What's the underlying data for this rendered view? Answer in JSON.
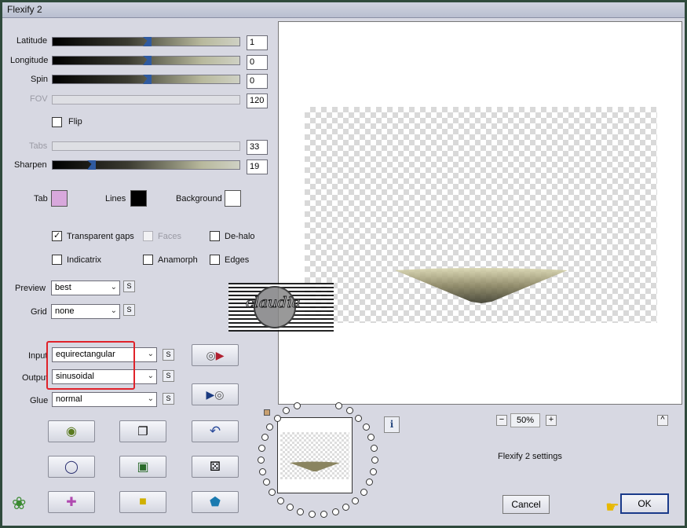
{
  "window": {
    "title": "Flexify 2"
  },
  "sliders": [
    {
      "label": "Latitude",
      "value": "1",
      "enabled": true,
      "level": 0.5
    },
    {
      "label": "Longitude",
      "value": "0",
      "enabled": true,
      "level": 0.5
    },
    {
      "label": "Spin",
      "value": "0",
      "enabled": true,
      "level": 0.5
    },
    {
      "label": "FOV",
      "value": "120",
      "enabled": false,
      "level": 0
    },
    {
      "label": "Tabs",
      "value": "33",
      "enabled": false,
      "level": 0
    },
    {
      "label": "Sharpen",
      "value": "19",
      "enabled": true,
      "level": 0.2
    }
  ],
  "flip": {
    "label": "Flip",
    "checked": false
  },
  "colors": {
    "tab": {
      "label": "Tab",
      "hex": "#d8a8dc"
    },
    "lines": {
      "label": "Lines",
      "hex": "#000000"
    },
    "background": {
      "label": "Background",
      "hex": "#ffffff"
    }
  },
  "checkboxes": {
    "transparent_gaps": {
      "label": "Transparent gaps",
      "checked": true
    },
    "faces": {
      "label": "Faces",
      "checked": false,
      "enabled": false
    },
    "de_halo": {
      "label": "De-halo",
      "checked": false
    },
    "indicatrix": {
      "label": "Indicatrix",
      "checked": false
    },
    "anamorph": {
      "label": "Anamorph",
      "checked": false
    },
    "edges": {
      "label": "Edges",
      "checked": false
    }
  },
  "selects": {
    "preview": {
      "label": "Preview",
      "value": "best"
    },
    "grid": {
      "label": "Grid",
      "value": "none"
    },
    "input": {
      "label": "Input",
      "value": "equirectangular"
    },
    "output": {
      "label": "Output",
      "value": "sinusoidal"
    },
    "glue": {
      "label": "Glue",
      "value": "normal"
    }
  },
  "small_button_label": "S",
  "zoom": {
    "value": "50%",
    "minus": "−",
    "plus": "+"
  },
  "settings_label": "Flexify 2 settings",
  "info_label": "i",
  "caret_label": "^",
  "buttons": {
    "cancel": "Cancel",
    "ok": "OK"
  },
  "watermark_text": "claudia",
  "accent": {
    "highlight_red": "#e0222a",
    "slider_thumb": "#2f5aa0"
  }
}
